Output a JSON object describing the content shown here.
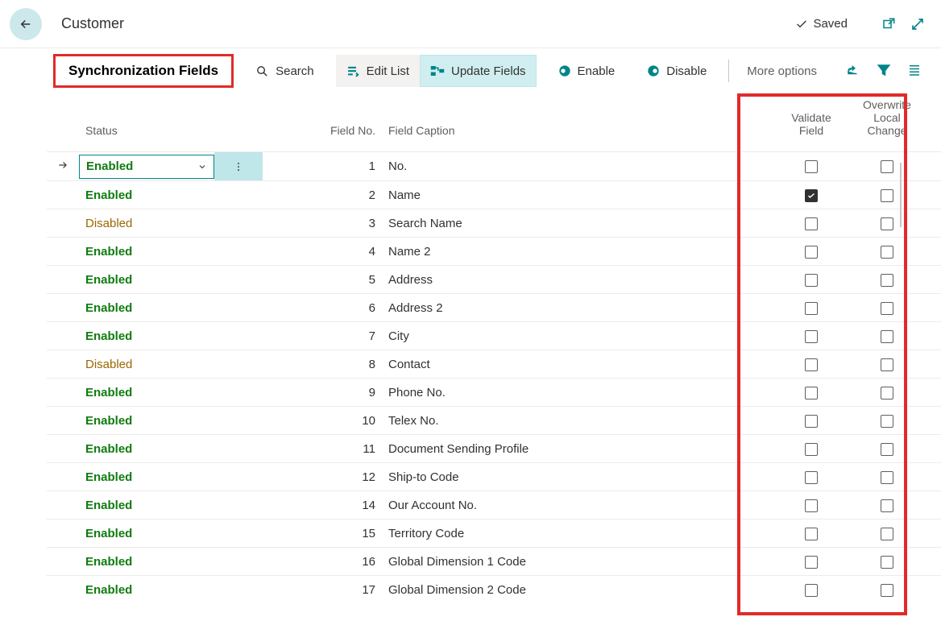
{
  "header": {
    "title": "Customer",
    "saved_label": "Saved"
  },
  "toolbar": {
    "sync_fields": "Synchronization Fields",
    "search": "Search",
    "edit_list": "Edit List",
    "update_fields": "Update Fields",
    "enable": "Enable",
    "disable": "Disable",
    "more_options": "More options"
  },
  "columns": {
    "status": "Status",
    "field_no": "Field No.",
    "field_caption": "Field Caption",
    "validate_field": "Validate Field",
    "overwrite_local": "Overwrite Local Change"
  },
  "rows": [
    {
      "status": "Enabled",
      "field_no": 1,
      "caption": "No.",
      "validate": false,
      "overwrite": false
    },
    {
      "status": "Enabled",
      "field_no": 2,
      "caption": "Name",
      "validate": true,
      "overwrite": false
    },
    {
      "status": "Disabled",
      "field_no": 3,
      "caption": "Search Name",
      "validate": false,
      "overwrite": false
    },
    {
      "status": "Enabled",
      "field_no": 4,
      "caption": "Name 2",
      "validate": false,
      "overwrite": false
    },
    {
      "status": "Enabled",
      "field_no": 5,
      "caption": "Address",
      "validate": false,
      "overwrite": false
    },
    {
      "status": "Enabled",
      "field_no": 6,
      "caption": "Address 2",
      "validate": false,
      "overwrite": false
    },
    {
      "status": "Enabled",
      "field_no": 7,
      "caption": "City",
      "validate": false,
      "overwrite": false
    },
    {
      "status": "Disabled",
      "field_no": 8,
      "caption": "Contact",
      "validate": false,
      "overwrite": false
    },
    {
      "status": "Enabled",
      "field_no": 9,
      "caption": "Phone No.",
      "validate": false,
      "overwrite": false
    },
    {
      "status": "Enabled",
      "field_no": 10,
      "caption": "Telex No.",
      "validate": false,
      "overwrite": false
    },
    {
      "status": "Enabled",
      "field_no": 11,
      "caption": "Document Sending Profile",
      "validate": false,
      "overwrite": false
    },
    {
      "status": "Enabled",
      "field_no": 12,
      "caption": "Ship-to Code",
      "validate": false,
      "overwrite": false
    },
    {
      "status": "Enabled",
      "field_no": 14,
      "caption": "Our Account No.",
      "validate": false,
      "overwrite": false
    },
    {
      "status": "Enabled",
      "field_no": 15,
      "caption": "Territory Code",
      "validate": false,
      "overwrite": false
    },
    {
      "status": "Enabled",
      "field_no": 16,
      "caption": "Global Dimension 1 Code",
      "validate": false,
      "overwrite": false
    },
    {
      "status": "Enabled",
      "field_no": 17,
      "caption": "Global Dimension 2 Code",
      "validate": false,
      "overwrite": false
    }
  ]
}
